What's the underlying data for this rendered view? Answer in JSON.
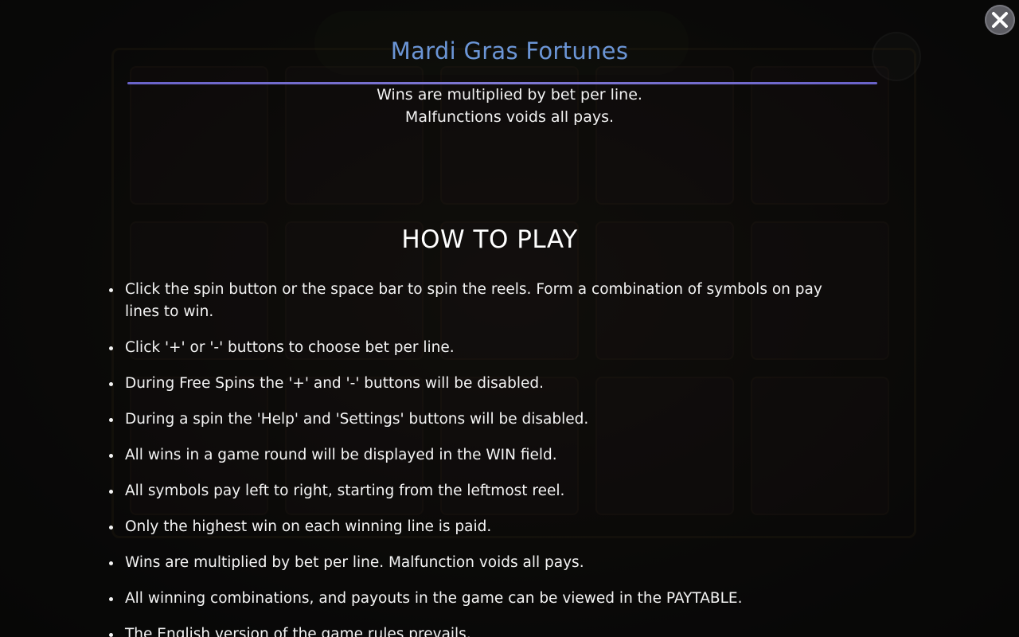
{
  "game": {
    "title": "Mardi Gras Fortunes",
    "subtitle_lines": [
      "Wins are multiplied by bet per line.",
      "Malfunctions voids all pays."
    ]
  },
  "help": {
    "heading": "HOW TO PLAY",
    "rules": [
      "Click the spin button or the space bar to spin the reels. Form a combination of symbols on pay lines to win.",
      "Click '+' or '-' buttons to choose bet per line.",
      "During Free Spins the '+' and '-' buttons will be disabled.",
      "During a spin the 'Help' and 'Settings' buttons will be disabled.",
      "All wins in a game round will be displayed in the WIN field.",
      "All symbols pay left to right, starting from the leftmost reel.",
      "Only the highest win on each winning line is paid.",
      "Wins are multiplied by bet per line. Malfunction voids all pays.",
      "All winning combinations, and payouts in the game can be viewed in the PAYTABLE.",
      "The English version of the game rules prevails."
    ]
  },
  "controls": {
    "close_icon": "close-icon"
  },
  "colors": {
    "title": "#6b95d6",
    "divider": "#6a63c9",
    "text": "#f4f4f4",
    "close_bg": "#5d5d63"
  }
}
